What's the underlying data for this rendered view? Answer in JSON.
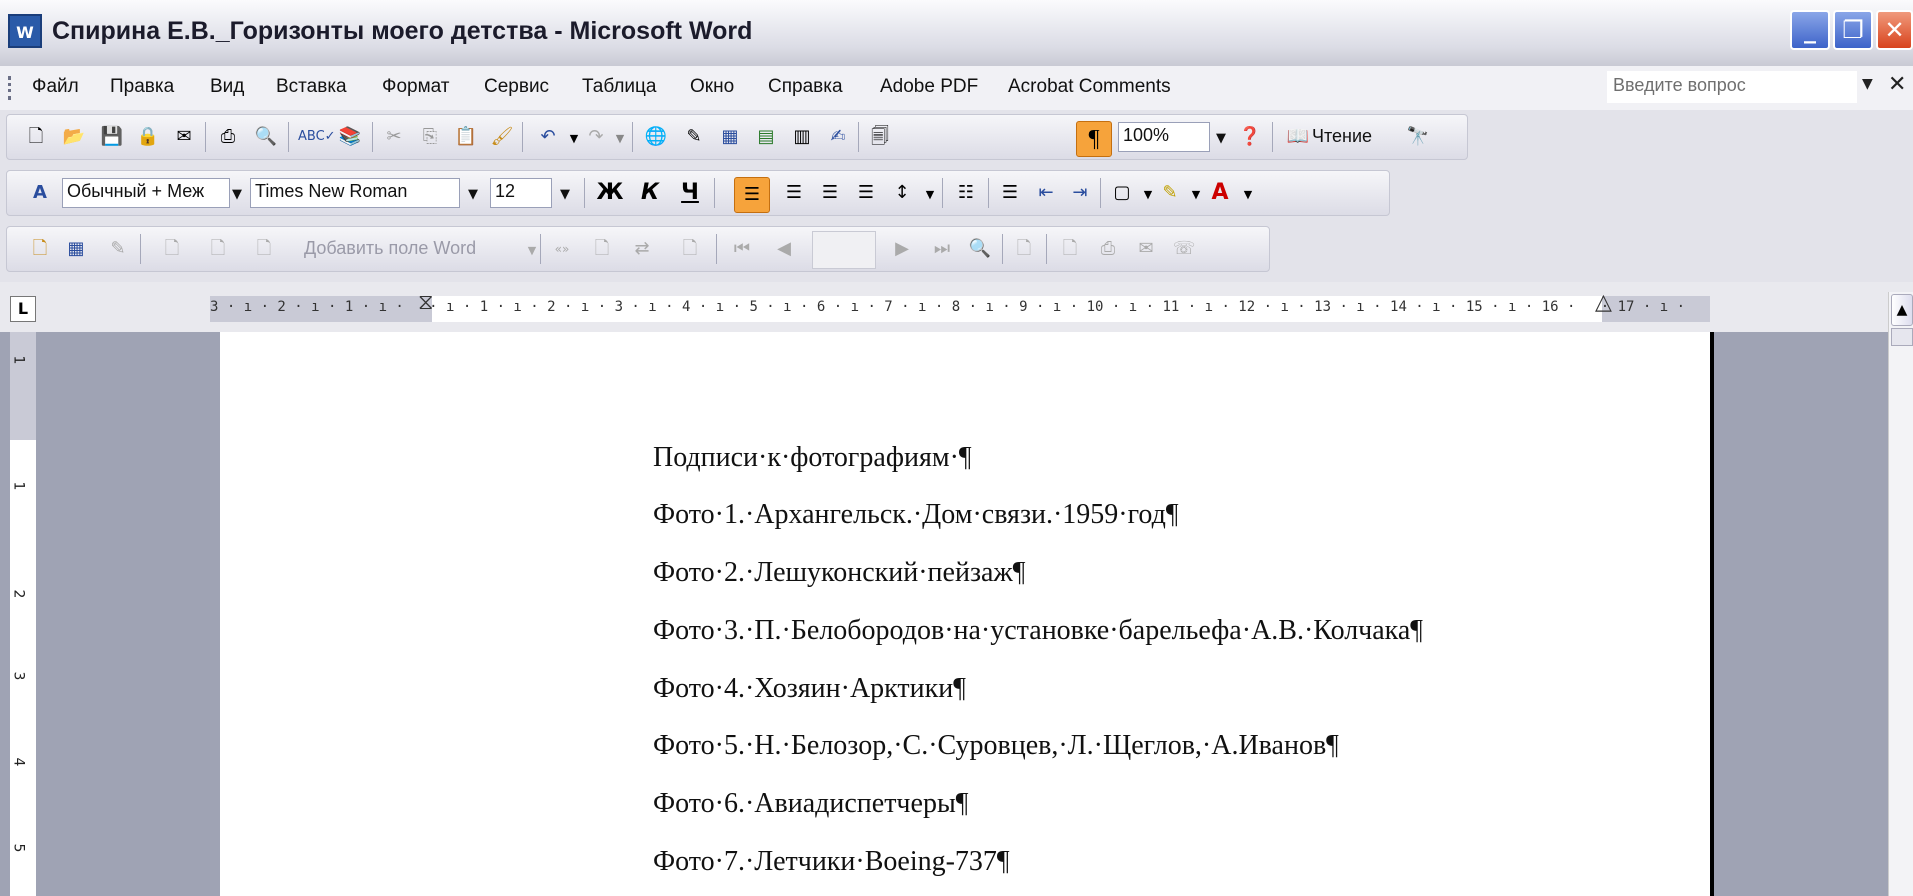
{
  "window": {
    "title": "Спирина Е.В._Горизонты моего детства - Microsoft Word",
    "app_icon": "W"
  },
  "menu": {
    "items": [
      "Файл",
      "Правка",
      "Вид",
      "Вставка",
      "Формат",
      "Сервис",
      "Таблица",
      "Окно",
      "Справка",
      "Adobe PDF",
      "Acrobat Comments"
    ],
    "help_placeholder": "Введите вопрос"
  },
  "standard_toolbar": {
    "zoom": "100%",
    "read_label": "Чтение"
  },
  "formatting_toolbar": {
    "style": "Обычный + Меж",
    "font": "Times New Roman",
    "size": "12",
    "bold_label": "Ж",
    "italic_label": "К",
    "underline_label": "Ч"
  },
  "mailmerge_toolbar": {
    "add_field_label": "Добавить поле Word"
  },
  "ruler": {
    "horizontal_labels": "3 · ı · 2 · ı · 1 · ı ·   · ı · 1 · ı · 2 · ı · 3 · ı · 4 · ı · 5 · ı · 6 · ı · 7 · ı · 8 · ı · 9 · ı · 10 · ı · 11 · ı · 12 · ı · 13 · ı · 14 · ı · 15 · ı · 16 ·   · 17 · ı ·",
    "vertical_labels": [
      "1",
      "1",
      "2",
      "3",
      "4",
      "5"
    ],
    "tab_selector": "L"
  },
  "document": {
    "lines": [
      "Подписи·к·фотографиям·¶",
      "Фото·1.·Архангельск.·Дом·связи.·1959·год¶",
      "Фото·2.·Лешуконский·пейзаж¶",
      "Фото·3.·П.·Белобородов·на·установке·барельефа·А.В.·Колчака¶",
      "Фото·4.·Хозяин·Арктики¶",
      "Фото·5.·Н.·Белозор,·С.·Суровцев,·Л.·Щеглов,·А.Иванов¶",
      "Фото·6.·Авиадиспетчеры¶",
      "Фото·7.·Летчики·Boeing-737¶"
    ]
  },
  "colors": {
    "titlebar_close": "#d8431d",
    "toolbar_active": "#f6a33b",
    "workspace": "#9fa3b4"
  }
}
